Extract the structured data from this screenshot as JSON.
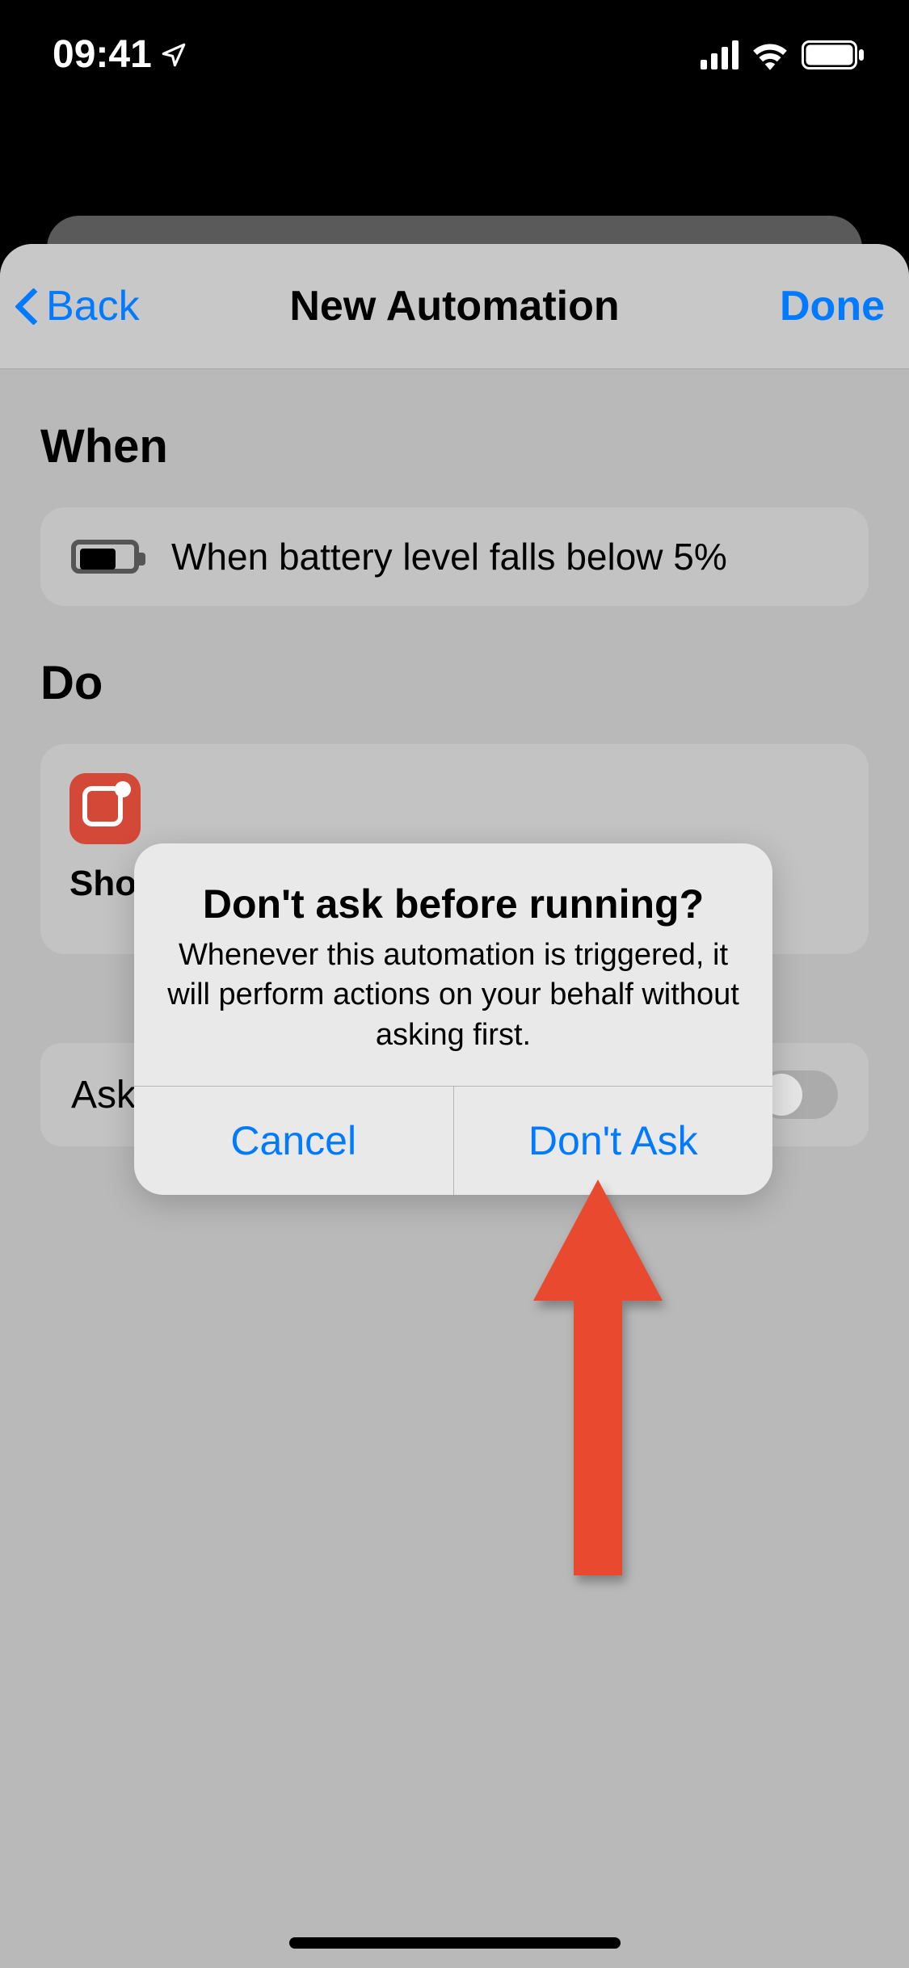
{
  "status": {
    "time": "09:41"
  },
  "nav": {
    "back": "Back",
    "title": "New Automation",
    "done": "Done"
  },
  "when": {
    "header": "When",
    "trigger_text": "When battery level falls below 5%"
  },
  "do": {
    "header": "Do",
    "action_label_truncated": "Sho"
  },
  "ask_row": {
    "label": "Ask"
  },
  "alert": {
    "title": "Don't ask before running?",
    "message": "Whenever this automation is triggered, it will perform actions on your behalf without asking first.",
    "cancel": "Cancel",
    "confirm": "Don't Ask"
  },
  "annotation": {
    "arrow_color": "#e94a2f"
  }
}
